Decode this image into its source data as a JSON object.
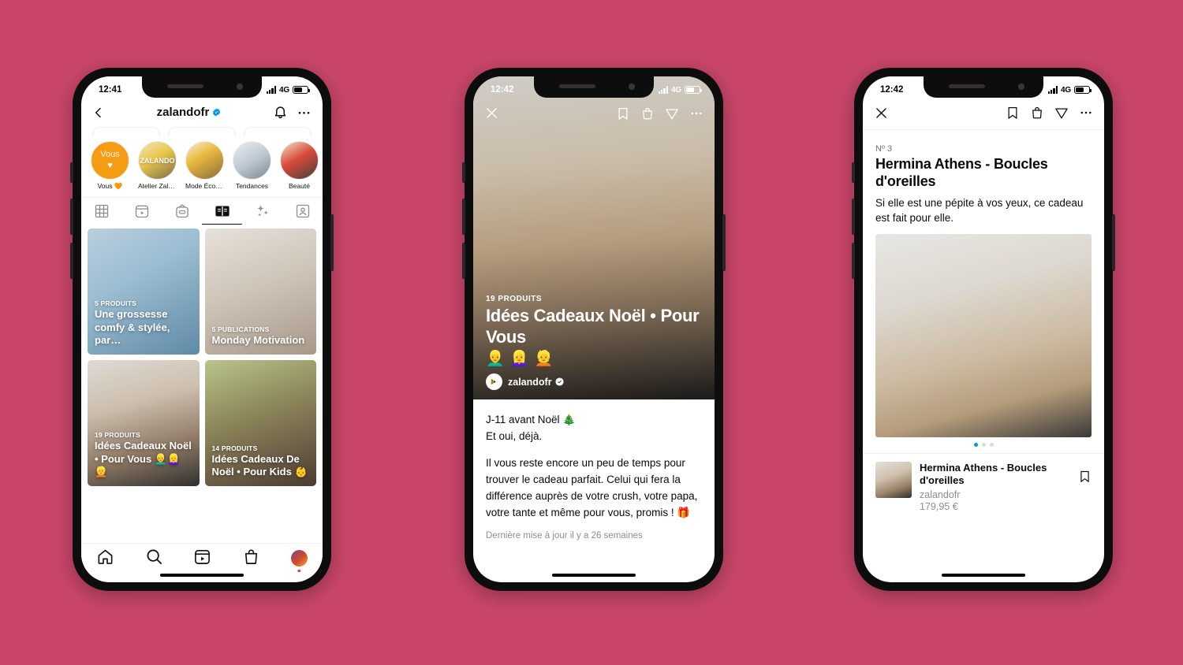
{
  "background_color": "#c9466a",
  "phone1": {
    "status_bar": {
      "time": "12:41",
      "network": "4G"
    },
    "header": {
      "title": "zalandofr",
      "back_icon": "chevron-left-icon",
      "bell_icon": "bell-icon",
      "more_icon": "more-horizontal-icon"
    },
    "highlights": [
      {
        "label": "Vous 🧡",
        "badge": "Vous"
      },
      {
        "label": "Atelier Zala..."
      },
      {
        "label": "Mode Éco ♻️"
      },
      {
        "label": "Tendances"
      },
      {
        "label": "Beauté"
      }
    ],
    "profile_tabs": [
      {
        "icon": "grid-icon",
        "active": false
      },
      {
        "icon": "reels-icon",
        "active": false
      },
      {
        "icon": "igtv-icon",
        "active": false
      },
      {
        "icon": "guides-icon",
        "active": true
      },
      {
        "icon": "sparkles-icon",
        "active": false
      },
      {
        "icon": "tagged-icon",
        "active": false
      }
    ],
    "guides": [
      {
        "kicker": "5 PRODUITS",
        "title": "Une grossesse comfy & stylée, par…"
      },
      {
        "kicker": "5 PUBLICATIONS",
        "title": "Monday Motivation"
      },
      {
        "kicker": "19 PRODUITS",
        "title": "Idées Cadeaux Noël • Pour Vous 👱‍♂️👱‍♀️👱"
      },
      {
        "kicker": "14 PRODUITS",
        "title": "Idées Cadeaux De Noël • Pour Kids 👶"
      }
    ],
    "bottom_nav": [
      {
        "icon": "home-icon"
      },
      {
        "icon": "search-icon"
      },
      {
        "icon": "reels-icon"
      },
      {
        "icon": "shop-bag-icon"
      },
      {
        "icon": "profile-avatar"
      }
    ]
  },
  "phone2": {
    "status_bar": {
      "time": "12:42",
      "network": "4G"
    },
    "topbar": {
      "close_icon": "close-icon",
      "save_icon": "bookmark-icon",
      "shop_icon": "shop-bag-icon",
      "share_icon": "send-icon",
      "more_icon": "more-horizontal-icon"
    },
    "hero": {
      "kicker": "19 PRODUITS",
      "title": "Idées Cadeaux Noël • Pour Vous",
      "emojis": "👱‍♂️ 👱‍♀️ 👱",
      "author": "zalandofr"
    },
    "body": {
      "line1": "J-11 avant Noël 🎄",
      "line2": "Et oui, déjà.",
      "paragraph": "Il vous reste encore un peu de temps pour trouver le cadeau parfait. Celui qui fera la différence auprès de votre crush, votre papa, votre tante et même pour vous, promis ! 🎁",
      "updated": "Dernière mise à jour il y a 26 semaines"
    }
  },
  "phone3": {
    "status_bar": {
      "time": "12:42",
      "network": "4G"
    },
    "topbar": {
      "close_icon": "close-icon",
      "save_icon": "bookmark-icon",
      "shop_icon": "shop-bag-icon",
      "share_icon": "send-icon",
      "more_icon": "more-horizontal-icon"
    },
    "entry": {
      "number": "Nº 3",
      "title": "Hermina Athens - Boucles d'oreilles",
      "description": "Si elle est une pépite à vos yeux, ce cadeau est fait pour elle."
    },
    "carousel": {
      "total_dots": 3,
      "active_index": 0
    },
    "product": {
      "name": "Hermina Athens - Boucles d'oreilles",
      "brand": "zalandofr",
      "price": "179,95 €",
      "save_icon": "bookmark-icon"
    }
  }
}
